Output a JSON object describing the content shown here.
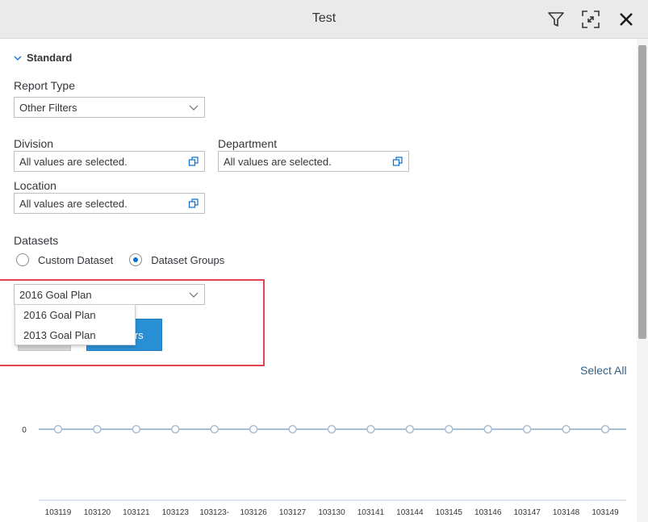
{
  "window": {
    "title": "Test"
  },
  "icons": {
    "filter": "filter-icon",
    "expand": "expand-icon",
    "close": "close-icon",
    "value_help": "value-help-icon",
    "chevron": "chevron-down-icon"
  },
  "colors": {
    "accent": "#0a6ed1",
    "button_primary": "#2a90d6",
    "highlight": "#e0474c",
    "link": "#346187",
    "chart_line": "#a7bfd6"
  },
  "section": {
    "label": "Standard"
  },
  "report_type": {
    "label": "Report Type",
    "value": "Other Filters"
  },
  "division": {
    "label": "Division",
    "value": "All values are selected."
  },
  "department": {
    "label": "Department",
    "value": "All values are selected."
  },
  "location": {
    "label": "Location",
    "value": "All values are selected."
  },
  "datasets": {
    "label": "Datasets",
    "options": [
      {
        "label": "Custom Dataset",
        "selected": false
      },
      {
        "label": "Dataset Groups",
        "selected": true
      }
    ]
  },
  "dataset_group": {
    "value": "2016 Goal Plan",
    "options": [
      "2016 Goal Plan",
      "2013 Goal Plan"
    ]
  },
  "apply_button": {
    "visible_label": "ters"
  },
  "select_all": {
    "label": "Select All"
  },
  "chart_data": {
    "type": "line",
    "categories": [
      "103119",
      "103120",
      "103121",
      "103123",
      "103123-",
      "103126",
      "103127",
      "103130",
      "103141",
      "103144",
      "103145",
      "103146",
      "103147",
      "103148",
      "103149"
    ],
    "values": [
      0,
      0,
      0,
      0,
      0,
      0,
      0,
      0,
      0,
      0,
      0,
      0,
      0,
      0,
      0
    ],
    "y_tick_labels": [
      "0"
    ],
    "markers": true
  }
}
